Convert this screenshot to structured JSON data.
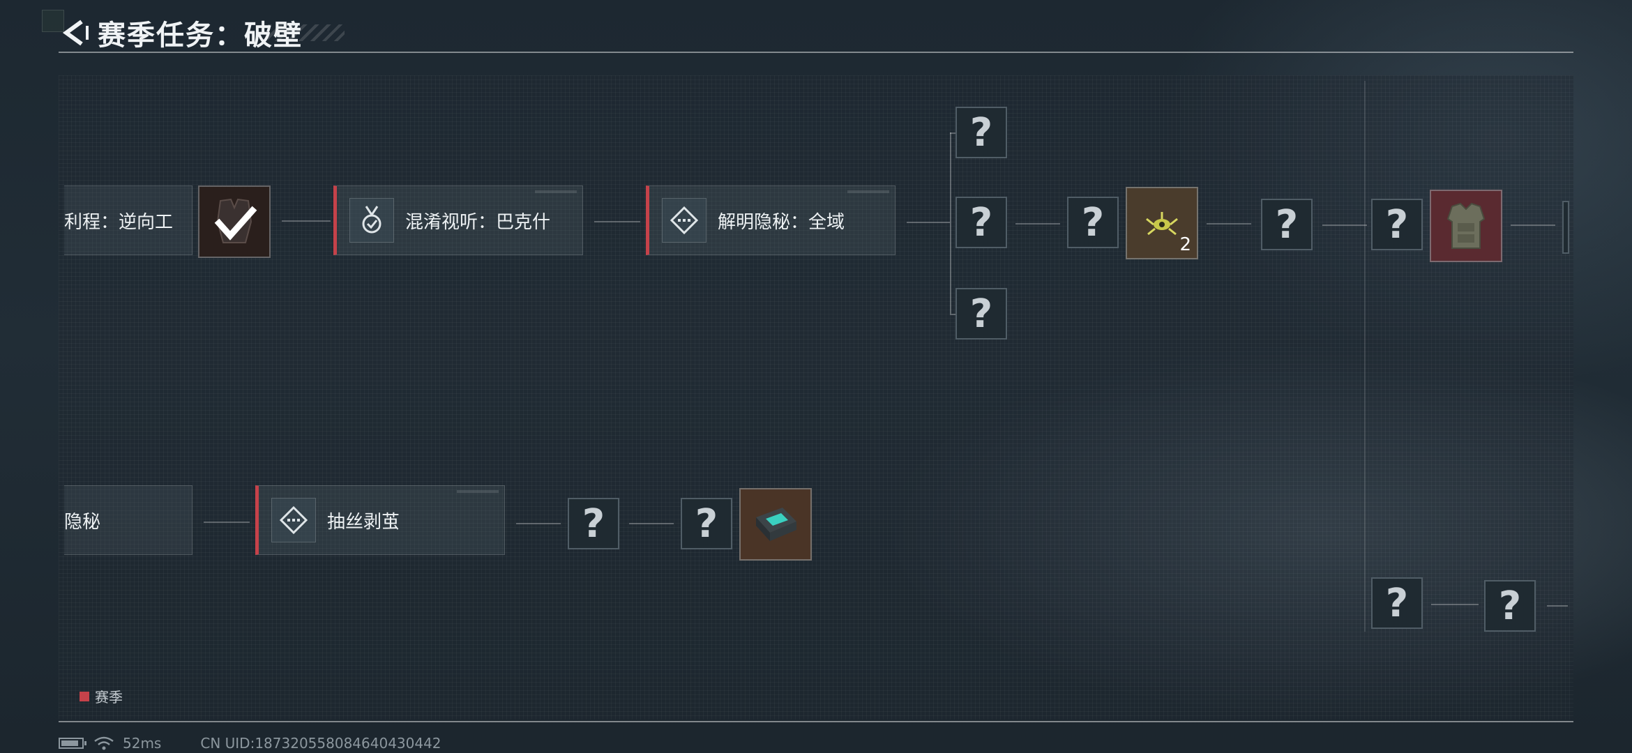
{
  "header": {
    "title": "赛季任务：破壁"
  },
  "tasks": {
    "t1": "利程：逆向工",
    "t2": "混淆视听：巴克什",
    "t3": "解明隐秘：全域",
    "t4": "隐秘",
    "t5": "抽丝剥茧"
  },
  "unknown_mark": "?",
  "rewards": {
    "grenade_count": "2"
  },
  "legend": {
    "label": "赛季",
    "color": "#c6424a"
  },
  "footer": {
    "battery_level": 0.85,
    "ping": "52ms",
    "uid": "CN UID:187320558084640430442"
  },
  "colors": {
    "accent": "#c6424a",
    "completed_check": "#ffffff"
  },
  "icons": [
    "back-arrow-icon",
    "medal-check-icon",
    "diamond-dots-icon",
    "checkmark-icon",
    "wifi-icon",
    "battery-icon"
  ]
}
